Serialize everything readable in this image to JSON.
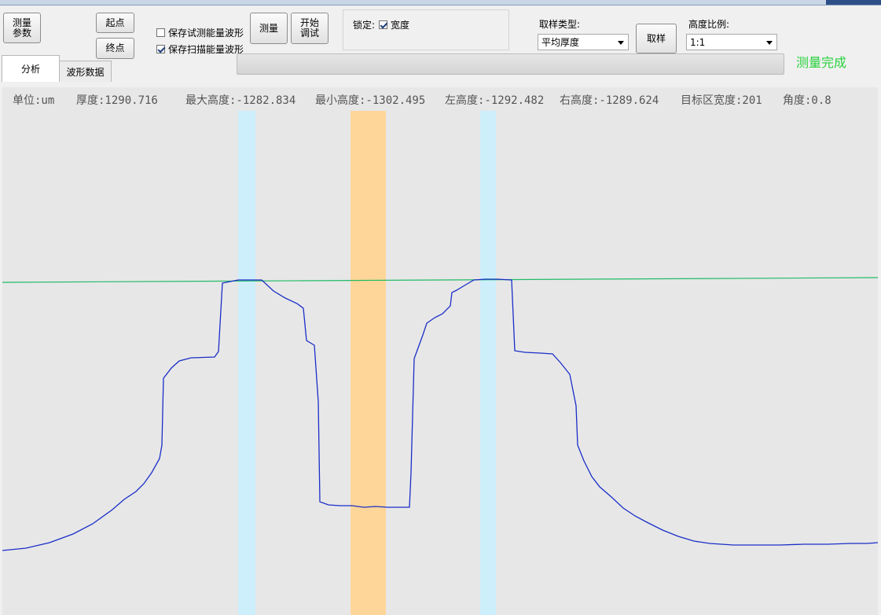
{
  "toolbar": {
    "measure_params": "测量\n参数",
    "start_point": "起点",
    "end_point": "终点",
    "save_test_wave": "保存试测能量波形",
    "save_scan_wave": "保存扫描能量波形",
    "measure": "测量",
    "start_debug": "开始\n调试",
    "lock_label": "锁定:",
    "width_label": "宽度",
    "sampling_type_label": "取样类型:",
    "sampling_type_value": "平均厚度",
    "sample": "取样",
    "height_ratio_label": "高度比例:",
    "height_ratio_value": "1:1",
    "status": "测量完成",
    "progress": 0.0
  },
  "checkboxes": {
    "save_test_wave_checked": false,
    "save_scan_wave_checked": true,
    "width_checked": true
  },
  "tabs": [
    {
      "label": "分析",
      "active": true
    },
    {
      "label": "波形数据",
      "active": false
    }
  ],
  "info": {
    "unit": "单位:um",
    "thickness": "厚度:1290.716",
    "max_height": "最大高度:-1282.834",
    "min_height": "最小高度:-1302.495",
    "left_height": "左高度:-1292.482",
    "right_height": "右高度:-1289.624",
    "target_width": "目标区宽度:201",
    "angle": "角度:0.8"
  },
  "colors": {
    "baseline": "#22bb66",
    "waveform": "#1a2ec8",
    "marker_blue": "#cdeefb",
    "marker_orange": "#ffd699",
    "status": "#28d23c"
  }
}
